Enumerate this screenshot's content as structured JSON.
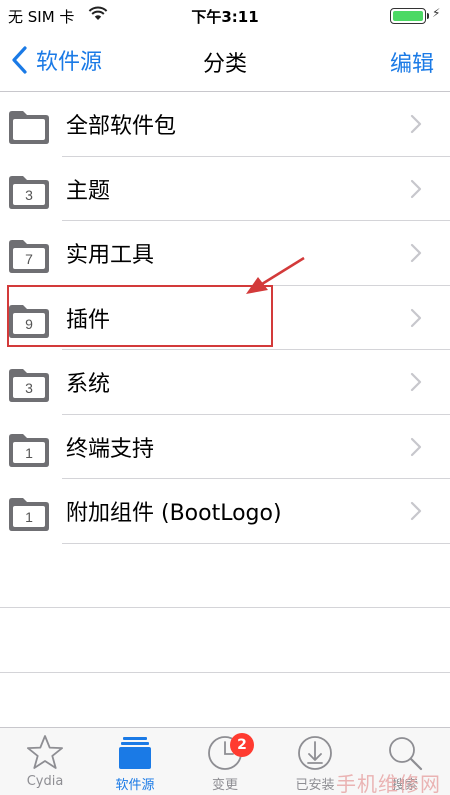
{
  "status_bar": {
    "carrier": "无 SIM 卡",
    "time": "下午3:11",
    "battery_level": 1.0,
    "charging_symbol": "⚡"
  },
  "nav": {
    "back_label": "软件源",
    "title": "分类",
    "edit_label": "编辑"
  },
  "sections": [
    {
      "label": "全部软件包",
      "count": "",
      "icon": "folder-icon",
      "highlighted": false
    },
    {
      "label": "主题",
      "count": "3",
      "icon": "folder-icon",
      "highlighted": false
    },
    {
      "label": "实用工具",
      "count": "7",
      "icon": "folder-icon",
      "highlighted": false
    },
    {
      "label": "插件",
      "count": "9",
      "icon": "folder-icon",
      "highlighted": true
    },
    {
      "label": "系统",
      "count": "3",
      "icon": "folder-icon",
      "highlighted": false
    },
    {
      "label": "终端支持",
      "count": "1",
      "icon": "folder-icon",
      "highlighted": false
    },
    {
      "label": "附加组件 (BootLogo)",
      "count": "1",
      "icon": "folder-icon",
      "highlighted": false
    }
  ],
  "tabs": [
    {
      "label": "Cydia",
      "icon": "star-icon",
      "active": false,
      "badge": ""
    },
    {
      "label": "软件源",
      "icon": "sources-icon",
      "active": true,
      "badge": ""
    },
    {
      "label": "变更",
      "icon": "clock-icon",
      "active": false,
      "badge": "2"
    },
    {
      "label": "已安装",
      "icon": "download-icon",
      "active": false,
      "badge": ""
    },
    {
      "label": "搜索",
      "icon": "search-icon",
      "active": false,
      "badge": ""
    }
  ],
  "watermark": "手机维修网",
  "colors": {
    "accent": "#1a7ae6",
    "annotation": "#d33a3a",
    "badge": "#ff3b30",
    "battery": "#4cd964"
  }
}
